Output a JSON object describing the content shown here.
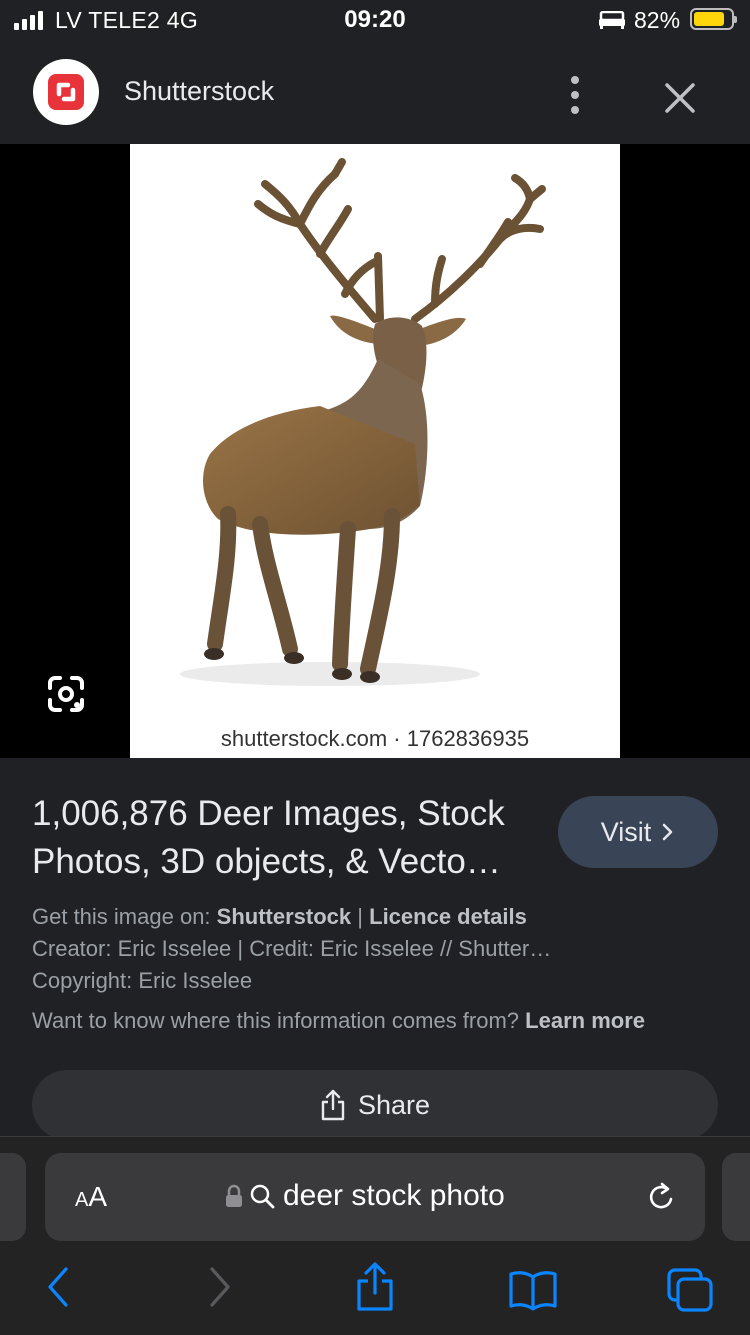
{
  "status_bar": {
    "carrier": "LV TELE2  4G",
    "time": "09:20",
    "battery": "82%",
    "battery_level": 0.82
  },
  "header": {
    "site_name": "Shutterstock",
    "logo_color": "#e8333b"
  },
  "image": {
    "watermark": "shutterstock.com · 1762836935"
  },
  "result": {
    "title": "1,006,876 Deer Images, Stock Photos, 3D objects, & Vecto…",
    "visit_label": "Visit",
    "get_image_prefix": "Get this image on:",
    "source": "Shutterstock",
    "separator": "|",
    "licence": "Licence details",
    "creator_line": "Creator: Eric Isselee | Credit: Eric Isselee // Shutter…",
    "copyright_line": "Copyright: Eric Isselee",
    "info_question": "Want to know where this information comes from?",
    "learn_more": "Learn more",
    "share_label": "Share"
  },
  "browser": {
    "text_size_small": "A",
    "text_size_large": "A",
    "url": "deer stock photo",
    "accent": "#0a84ff"
  }
}
